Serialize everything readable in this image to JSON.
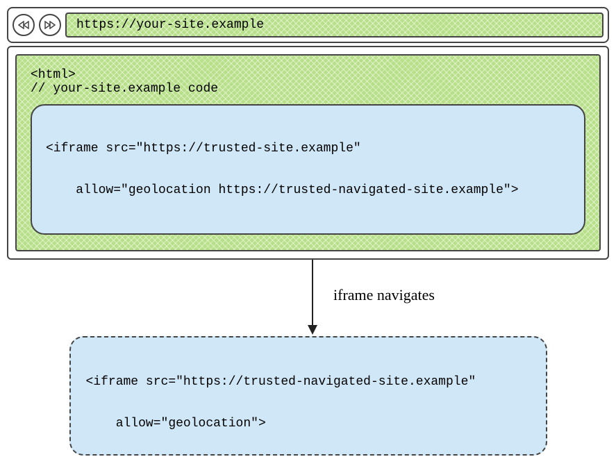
{
  "browser": {
    "address_url": "https://your-site.example"
  },
  "page": {
    "line1": "<html>",
    "line2": "// your-site.example code",
    "iframe_line1": "<iframe src=\"https://trusted-site.example\"",
    "iframe_line2": "    allow=\"geolocation https://trusted-navigated-site.example\">"
  },
  "arrow_label": "iframe navigates",
  "navigated": {
    "line1": "<iframe src=\"https://trusted-navigated-site.example\"",
    "line2": "    allow=\"geolocation\">"
  }
}
